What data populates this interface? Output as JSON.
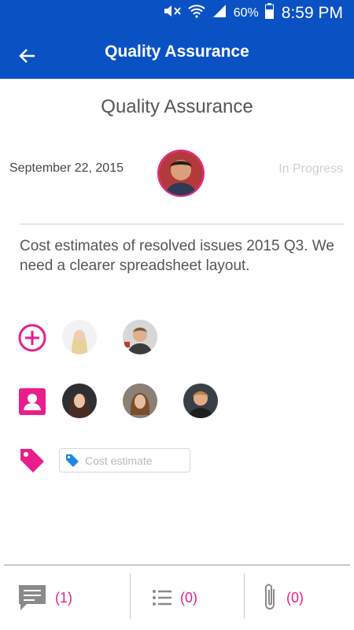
{
  "status_bar": {
    "battery": "60%",
    "time": "8:59 PM"
  },
  "header": {
    "title": "Quality Assurance",
    "back_icon": "arrow-back-icon"
  },
  "task": {
    "title": "Quality Assurance",
    "date": "September 22, 2015",
    "status": "In Progress",
    "description": "Cost estimates of resolved issues 2015 Q3. We need a clearer spreadsheet layout."
  },
  "followers": {
    "icon": "add-circle-icon",
    "count_shown": 2
  },
  "assignees": {
    "icon": "contact-card-icon",
    "count_shown": 3
  },
  "tags": {
    "icon": "tag-icon",
    "items": [
      "Cost estimate"
    ]
  },
  "bottom_bar": {
    "comments": "(1)",
    "checklist": "(0)",
    "attachments": "(0)"
  },
  "colors": {
    "brand": "#0a52c4",
    "accent": "#e91e8c"
  }
}
